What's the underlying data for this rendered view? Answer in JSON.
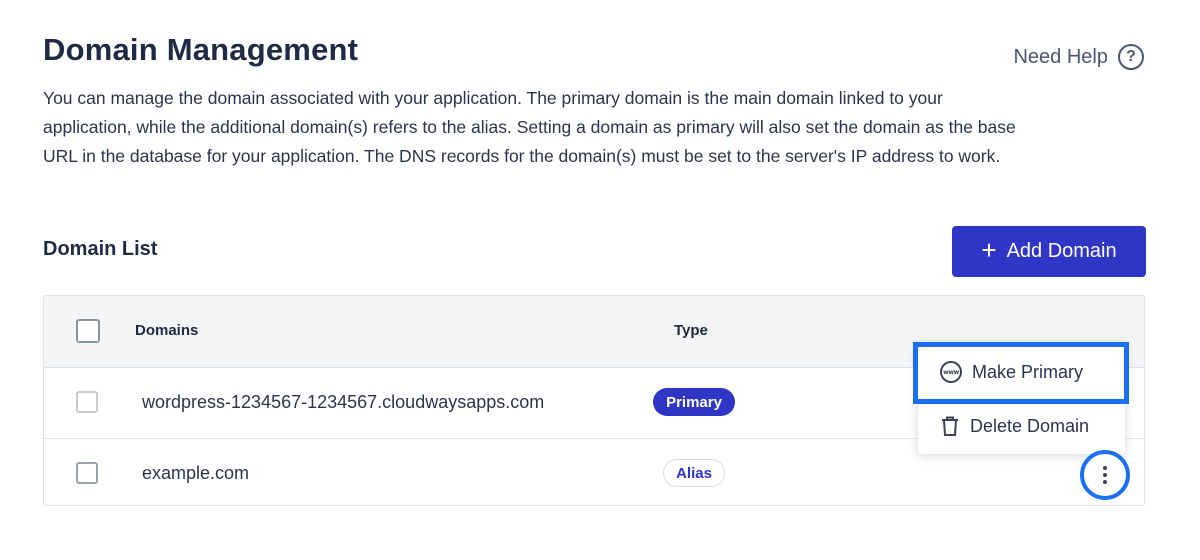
{
  "header": {
    "title": "Domain Management",
    "help_label": "Need Help",
    "help_icon": "question-circle-icon"
  },
  "description": "You can manage the domain associated with your application. The primary domain is the main domain linked to your application, while the additional domain(s) refers to the alias. Setting a domain as primary will also set the domain as the base URL in the database for your application. The DNS records for the domain(s) must be set to the server's IP address to work.",
  "domain_list": {
    "title": "Domain List",
    "add_button_label": "Add Domain",
    "add_button_icon": "plus-icon",
    "columns": {
      "domains": "Domains",
      "type": "Type"
    },
    "rows": [
      {
        "domain": "wordpress-1234567-1234567.cloudwaysapps.com",
        "type": "Primary"
      },
      {
        "domain": "example.com",
        "type": "Alias"
      }
    ]
  },
  "context_menu": {
    "items": [
      {
        "label": "Make Primary",
        "icon": "www-globe-icon"
      },
      {
        "label": "Delete Domain",
        "icon": "trash-icon"
      }
    ]
  },
  "colors": {
    "accent": "#2f35c4",
    "highlight": "#1a6ff3",
    "text": "#1f2a44"
  }
}
